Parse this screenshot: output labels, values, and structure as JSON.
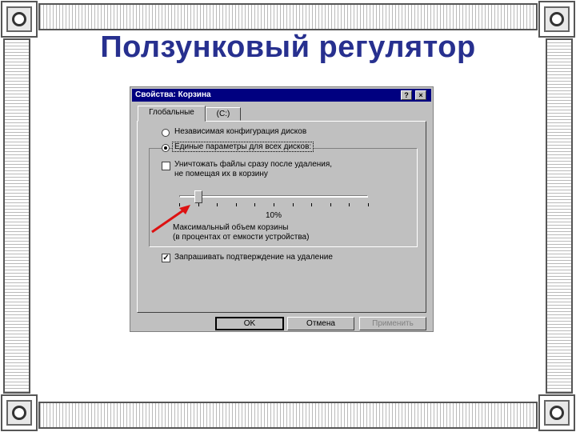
{
  "slide": {
    "title": "Ползунковый регулятор"
  },
  "dialog": {
    "title": "Свойства: Корзина",
    "help_button": "?",
    "close_button": "×",
    "tabs": [
      {
        "label": "Глобальные"
      },
      {
        "label": "(C:)"
      }
    ],
    "options": {
      "independent_label": "Независимая конфигурация дисков",
      "independent_selected": false,
      "single_label": "Единые параметры для всех дисков:",
      "single_selected": true
    },
    "delete_immediately": {
      "line1": "Уничтожать файлы сразу после удаления,",
      "line2": "не помещая их в корзину",
      "checked": false
    },
    "slider": {
      "value": 10,
      "value_label": "10%",
      "caption_line1": "Максимальный объем корзины",
      "caption_line2": "(в процентах от емкости устройства)"
    },
    "confirm_delete": {
      "label": "Запрашивать подтверждение на удаление",
      "checked": true
    },
    "buttons": {
      "ok": "OK",
      "cancel": "Отмена",
      "apply": "Применить"
    }
  },
  "colors": {
    "title_text": "#27308f",
    "titlebar": "#000080",
    "window_face": "#c0c0c0",
    "pointer_arrow": "#dd1111"
  }
}
